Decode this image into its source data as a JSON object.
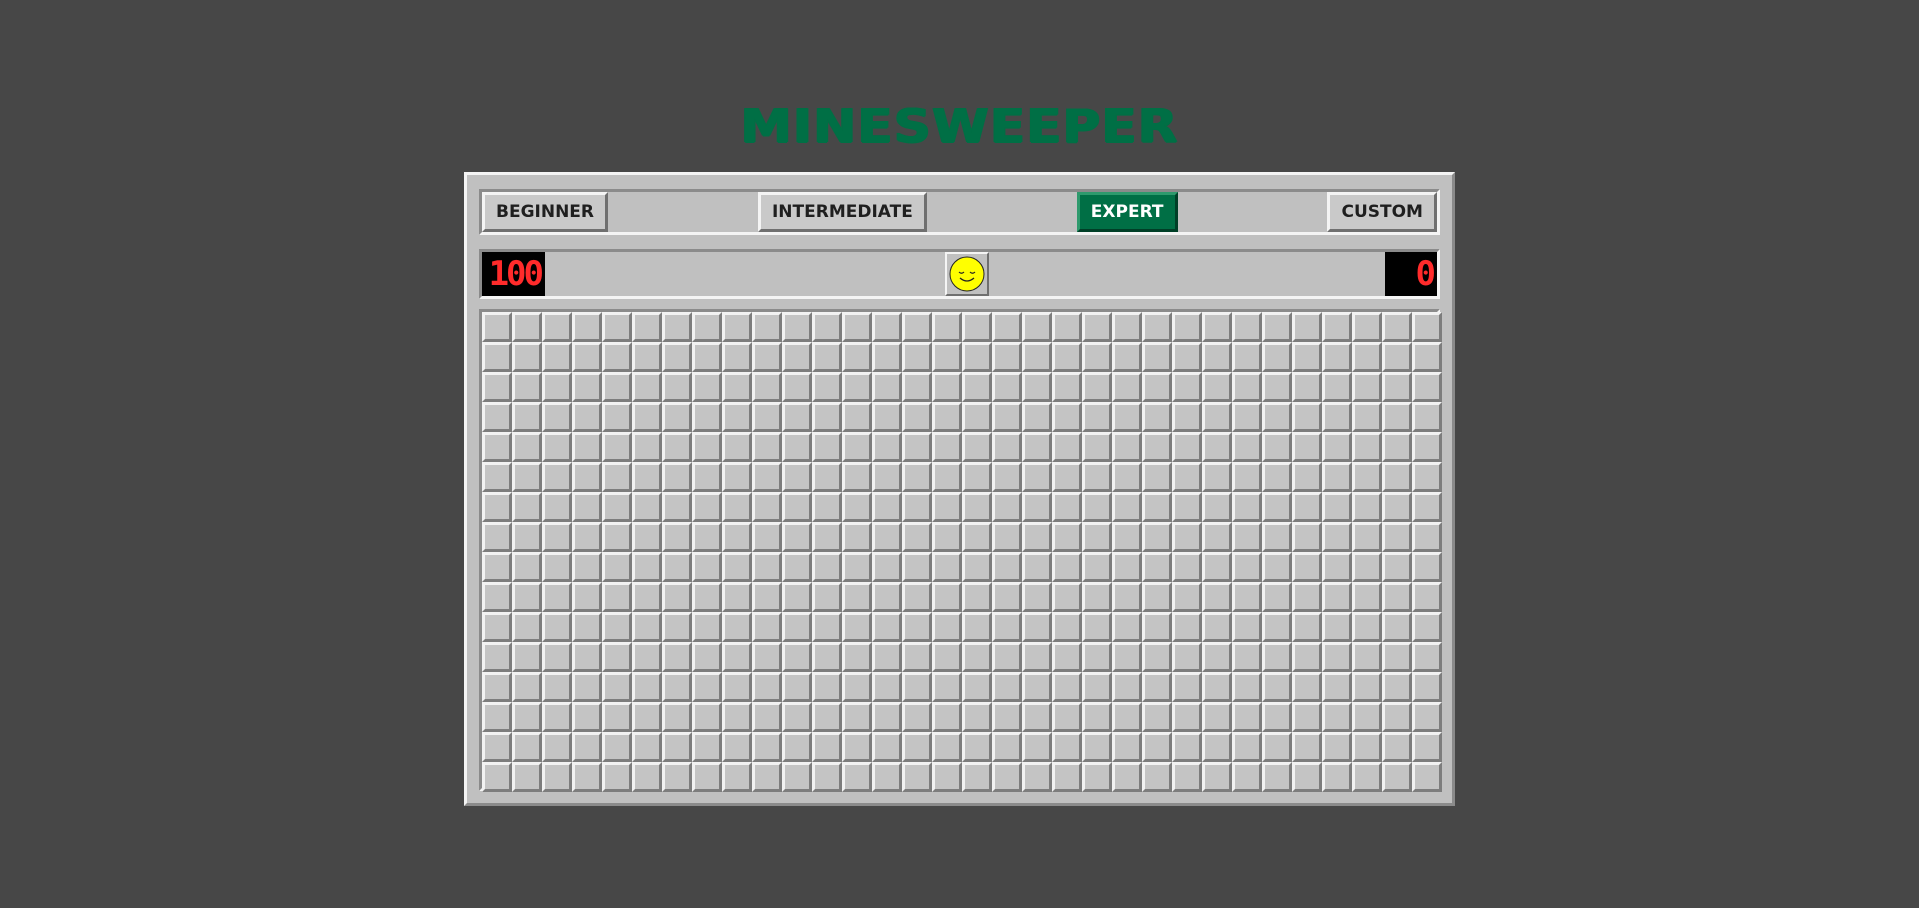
{
  "title": "MINESWEEPER",
  "levels": [
    {
      "label": "BEGINNER",
      "active": false
    },
    {
      "label": "INTERMEDIATE",
      "active": false
    },
    {
      "label": "EXPERT",
      "active": true
    },
    {
      "label": "CUSTOM",
      "active": false
    }
  ],
  "status": {
    "mines_remaining": "100",
    "timer": "0",
    "face": "smiley-face-icon"
  },
  "grid": {
    "rows": 16,
    "columns": 32
  },
  "colors": {
    "background": "#474747",
    "accent": "#006f45",
    "panel": "#c0c0c0",
    "counter_digits": "#ff2b2b",
    "face": "#ffff00"
  }
}
